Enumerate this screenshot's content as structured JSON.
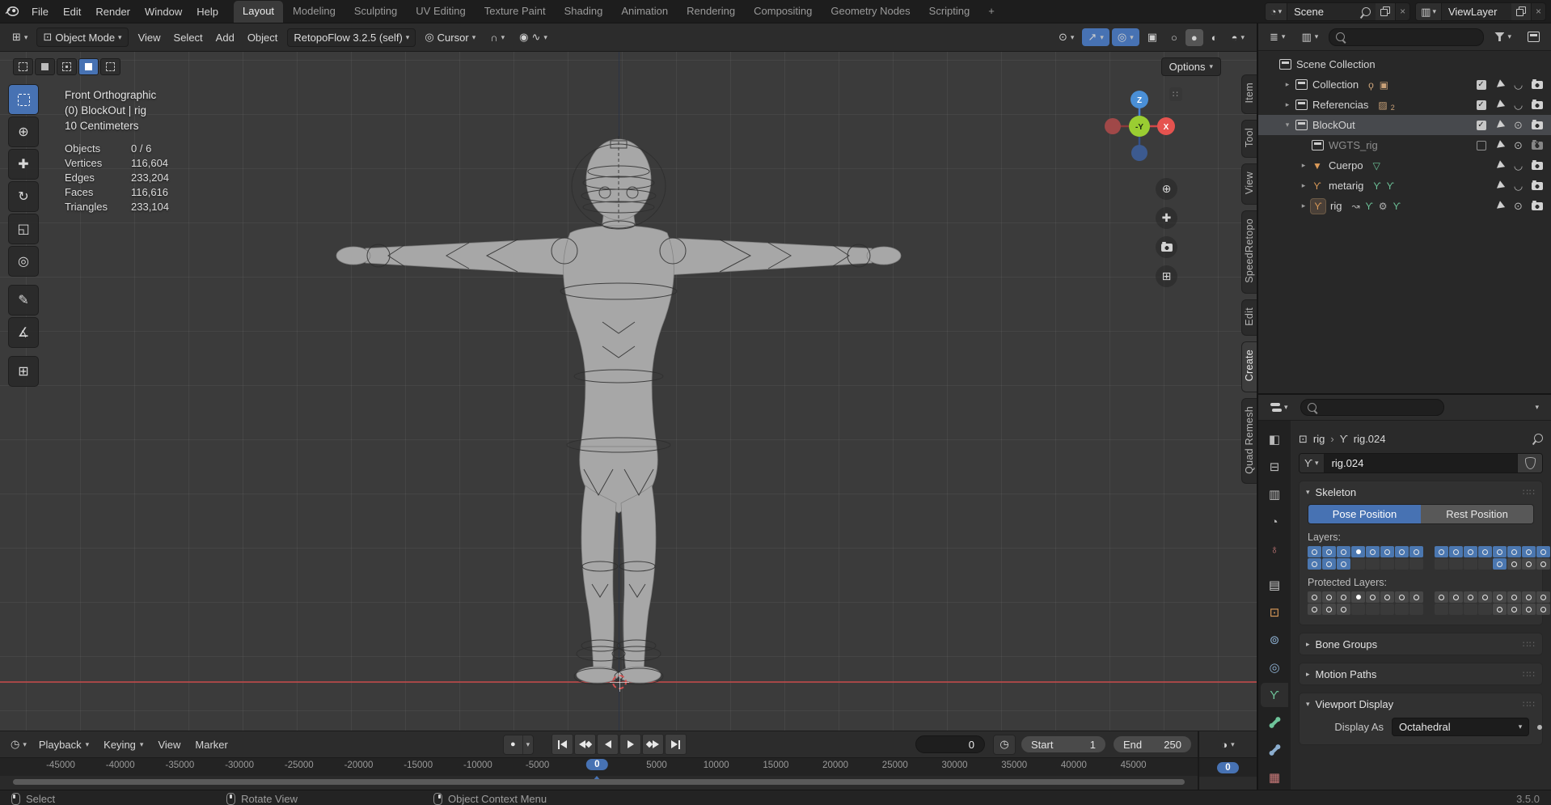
{
  "icons": {
    "caret": "▾",
    "expand_closed": "▸",
    "expand_open": "▾",
    "breadcrumb_sep": "›",
    "close": "×",
    "check": "✓",
    "plus": "+",
    "grip": "∷∷",
    "dots": "∷",
    "eye_open": "⊙",
    "eye_closed": "◡",
    "editor_timeline": "◷",
    "editor_outliner": "≣",
    "editor_viewlayer": "▥",
    "scene": "◔",
    "record": "●",
    "stopwatch": "◷",
    "mini_editor": "◑",
    "pivot": "◎",
    "snap": "∩",
    "prop_circle": "◉",
    "prop_falloff": "∿",
    "visibility": "⊙",
    "gizmo_toggle": "↗",
    "overlays": "◎",
    "xray": "▣",
    "shade_wire": "○",
    "shade_solid": "●",
    "shade_material": "◐",
    "shade_rendered": "◓",
    "editor_grid": "⊞",
    "mode_cube": "⊡",
    "zoom": "⊕",
    "pan": "✚",
    "cam_grid": "⊞",
    "mesh": "▼",
    "armature": "ϒ",
    "vgroup": "▽",
    "pose": "ϒ",
    "driver": "↝",
    "tool": "⚙",
    "light": "ϙ",
    "movie": "▣",
    "image": "▨",
    "render": "◧",
    "output": "⊟",
    "viewlayer_tab": "▥",
    "scene_tab": "◔",
    "world": "♁",
    "collection_tab": "▤",
    "object_tab": "⊡",
    "physics": "⊚",
    "constraint": "◎",
    "data_armature": "ϒ",
    "texture": "▦",
    "tools_glyphs": {
      "cursor": "⊕",
      "move": "✚",
      "rotate": "↻",
      "scale": "◱",
      "transform": "◎",
      "annotate": "✎",
      "measure": "∡",
      "add-cube": "⊞"
    }
  },
  "colors": {
    "accent": "#4772b3",
    "orange": "#dd9b59",
    "green": "#6ec49a",
    "blue_icon": "#8caecf",
    "red_icon": "#cc7b7b",
    "tan": "#c9a178"
  },
  "topbar": {
    "menus": [
      "File",
      "Edit",
      "Render",
      "Window",
      "Help"
    ],
    "workspaces": [
      "Layout",
      "Modeling",
      "Sculpting",
      "UV Editing",
      "Texture Paint",
      "Shading",
      "Animation",
      "Rendering",
      "Compositing",
      "Geometry Nodes",
      "Scripting"
    ],
    "active_workspace": "Layout",
    "new_workspace": "+",
    "scene": {
      "label": "Scene"
    },
    "view_layer": {
      "label": "ViewLayer"
    }
  },
  "viewport_header": {
    "mode": "Object Mode",
    "menus": [
      "View",
      "Select",
      "Add",
      "Object"
    ],
    "addon_button": "RetopoFlow 3.2.5 (self)",
    "pivot": "Cursor",
    "options": "Options"
  },
  "tools": [
    {
      "name": "select-box",
      "active": true
    },
    {
      "name": "cursor"
    },
    {
      "name": "move"
    },
    {
      "name": "rotate"
    },
    {
      "name": "scale"
    },
    {
      "name": "transform"
    },
    {
      "name": "annotate",
      "gap": true
    },
    {
      "name": "measure"
    },
    {
      "name": "add-cube",
      "gap": true
    }
  ],
  "viewport": {
    "view_label": "Front Orthographic",
    "context_label": "(0) BlockOut | rig",
    "scale_label": "10 Centimeters",
    "stats": [
      [
        "Objects",
        "0 / 6"
      ],
      [
        "Vertices",
        "116,604"
      ],
      [
        "Edges",
        "233,204"
      ],
      [
        "Faces",
        "116,616"
      ],
      [
        "Triangles",
        "233,104"
      ]
    ],
    "axis_labels": {
      "z": "Z",
      "x": "X",
      "y": "-Y"
    },
    "side_tabs": [
      "Item",
      "Tool",
      "View",
      "SpeedRetopo",
      "Edit",
      "Create",
      "Quad Remesh"
    ],
    "active_side_tab": "Create"
  },
  "outliner": {
    "rows": [
      {
        "label": "Scene Collection",
        "icon": "collection",
        "level": 0,
        "toggles": []
      },
      {
        "label": "Collection",
        "icon": "collection",
        "level": 1,
        "expand": "closed",
        "extras": [
          "light",
          "movie"
        ],
        "toggles": [
          "check",
          "pointer",
          "eye-closed",
          "camera"
        ]
      },
      {
        "label": "Referencias",
        "icon": "collection",
        "level": 1,
        "expand": "closed",
        "extras": [
          "image"
        ],
        "image_count": "2",
        "toggles": [
          "check",
          "pointer",
          "eye-closed",
          "camera"
        ]
      },
      {
        "label": "BlockOut",
        "icon": "collection",
        "level": 1,
        "expand": "open",
        "selected": true,
        "toggles": [
          "check",
          "pointer",
          "eye-open",
          "camera"
        ]
      },
      {
        "label": "WGTS_rig",
        "icon": "collection",
        "level": 2,
        "dim": true,
        "toggles": [
          "uncheck",
          "pointer",
          "eye-open",
          "camera-x"
        ]
      },
      {
        "label": "Cuerpo",
        "icon": "mesh",
        "level": 2,
        "expand": "closed",
        "extras": [
          "vgroup"
        ],
        "toggles": [
          "none",
          "pointer",
          "eye-closed",
          "camera"
        ]
      },
      {
        "label": "metarig",
        "icon": "armature",
        "level": 2,
        "expand": "closed",
        "extras": [
          "pose",
          "pose"
        ],
        "toggles": [
          "none",
          "pointer",
          "eye-closed",
          "camera"
        ]
      },
      {
        "label": "rig",
        "icon": "armature",
        "level": 2,
        "expand": "closed",
        "active": true,
        "extras": [
          "driver",
          "pose",
          "tool",
          "pose"
        ],
        "toggles": [
          "none",
          "pointer",
          "eye-open",
          "camera"
        ]
      }
    ]
  },
  "properties": {
    "tabs": [
      {
        "name": "render",
        "glyph": "render",
        "color": "#b9b9b9"
      },
      {
        "name": "output",
        "glyph": "output",
        "color": "#b9b9b9"
      },
      {
        "name": "view-layer",
        "glyph": "viewlayer_tab",
        "color": "#b9b9b9"
      },
      {
        "name": "scene",
        "glyph": "scene_tab",
        "color": "#b9b9b9"
      },
      {
        "name": "world",
        "glyph": "world",
        "color": "#cc7b7b"
      },
      {
        "name": "collection",
        "glyph": "collection_tab",
        "color": "#c9c9c9",
        "gap": true
      },
      {
        "name": "object",
        "glyph": "object_tab",
        "color": "#dd9b59"
      },
      {
        "name": "physics",
        "glyph": "physics",
        "color": "#8caecf"
      },
      {
        "name": "object-constraints",
        "glyph": "constraint",
        "color": "#8caecf"
      },
      {
        "name": "object-data",
        "glyph": "data_armature",
        "color": "#6ec49a",
        "active": true
      },
      {
        "name": "bone",
        "glyph": "bone",
        "color": "#6ec49a"
      },
      {
        "name": "bone-constraints",
        "glyph": "bone",
        "color": "#8caecf"
      },
      {
        "name": "texture",
        "glyph": "texture",
        "color": "#cc7b7b"
      }
    ],
    "breadcrumb": {
      "object": "rig",
      "data": "rig.024"
    },
    "name_value": "rig.024",
    "skeleton": {
      "title": "Skeleton",
      "pose": "Pose Position",
      "rest": "Rest Position",
      "layers_label": "Layers:",
      "layers_left": [
        [
          "o",
          "o",
          "o",
          "A",
          "o",
          "o",
          "o",
          "o"
        ],
        [
          "o",
          "o",
          "o",
          "-",
          "-",
          "-",
          "-",
          "-"
        ]
      ],
      "layers_right": [
        [
          "o",
          "o",
          "o",
          "o",
          "o",
          "o",
          "o",
          "o"
        ],
        [
          "-",
          "-",
          "-",
          "-",
          "o",
          "g",
          "g",
          "g"
        ]
      ],
      "protected_label": "Protected Layers:",
      "protected_left": [
        [
          "g",
          "g",
          "g",
          "P",
          "g",
          "g",
          "g",
          "g"
        ],
        [
          "g",
          "g",
          "g",
          "-",
          "-",
          "-",
          "-",
          "-"
        ]
      ],
      "protected_right": [
        [
          "g",
          "g",
          "g",
          "g",
          "g",
          "g",
          "g",
          "g"
        ],
        [
          "-",
          "-",
          "-",
          "-",
          "g",
          "g",
          "g",
          "g"
        ]
      ]
    },
    "collapsed_sections": [
      "Bone Groups",
      "Motion Paths"
    ],
    "viewport_display": {
      "title": "Viewport Display",
      "display_as_label": "Display As",
      "display_as_value": "Octahedral"
    }
  },
  "timeline": {
    "menus": [
      {
        "label": "Playback",
        "caret": true
      },
      {
        "label": "Keying",
        "caret": true
      },
      {
        "label": "View",
        "caret": false
      },
      {
        "label": "Marker",
        "caret": false
      }
    ],
    "frame_value": "0",
    "start_label": "Start",
    "start_value": "1",
    "end_label": "End",
    "end_value": "250",
    "ticks": [
      "-45000",
      "-40000",
      "-35000",
      "-30000",
      "-25000",
      "-20000",
      "-15000",
      "-10000",
      "-5000",
      "0",
      "5000",
      "10000",
      "15000",
      "20000",
      "25000",
      "30000",
      "35000",
      "40000",
      "45000"
    ],
    "current_tick": "0",
    "mini_frame": "0"
  },
  "statusbar": {
    "hints": [
      {
        "mouse": "left",
        "label": "Select"
      },
      {
        "mouse": "middle",
        "label": "Rotate View"
      },
      {
        "mouse": "right",
        "label": "Object Context Menu"
      }
    ],
    "version": "3.5.0"
  }
}
